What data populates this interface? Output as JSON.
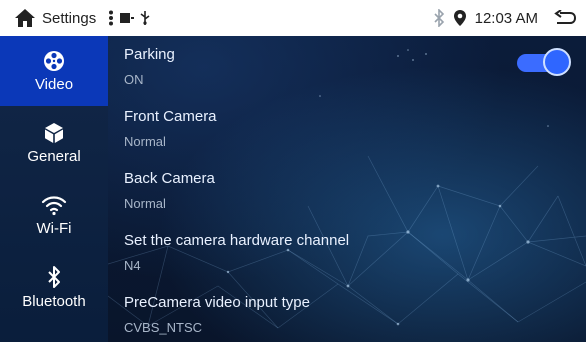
{
  "status_bar": {
    "title": "Settings",
    "time": "12:03 AM",
    "icons": [
      "home-icon",
      "more-vert-icon",
      "media-icon",
      "usb-icon",
      "bluetooth-icon",
      "location-pin-icon",
      "back-icon"
    ]
  },
  "sidebar": {
    "active": "video",
    "items": [
      {
        "label": "Video",
        "icon": "film-reel-icon"
      },
      {
        "label": "General",
        "icon": "cube-icon"
      },
      {
        "label": "Wi-Fi",
        "icon": "wifi-icon"
      },
      {
        "label": "Bluetooth",
        "icon": "bluetooth-icon"
      }
    ]
  },
  "settings": [
    {
      "title": "Parking",
      "value": "ON",
      "toggle": true
    },
    {
      "title": "Front Camera",
      "value": "Normal"
    },
    {
      "title": "Back Camera",
      "value": "Normal"
    },
    {
      "title": "Set the camera hardware channel",
      "value": "N4"
    },
    {
      "title": "PreCamera video input type",
      "value": "CVBS_NTSC"
    }
  ],
  "colors": {
    "active_tab": "#0b38b8",
    "toggle_on": "#3b6cff"
  }
}
